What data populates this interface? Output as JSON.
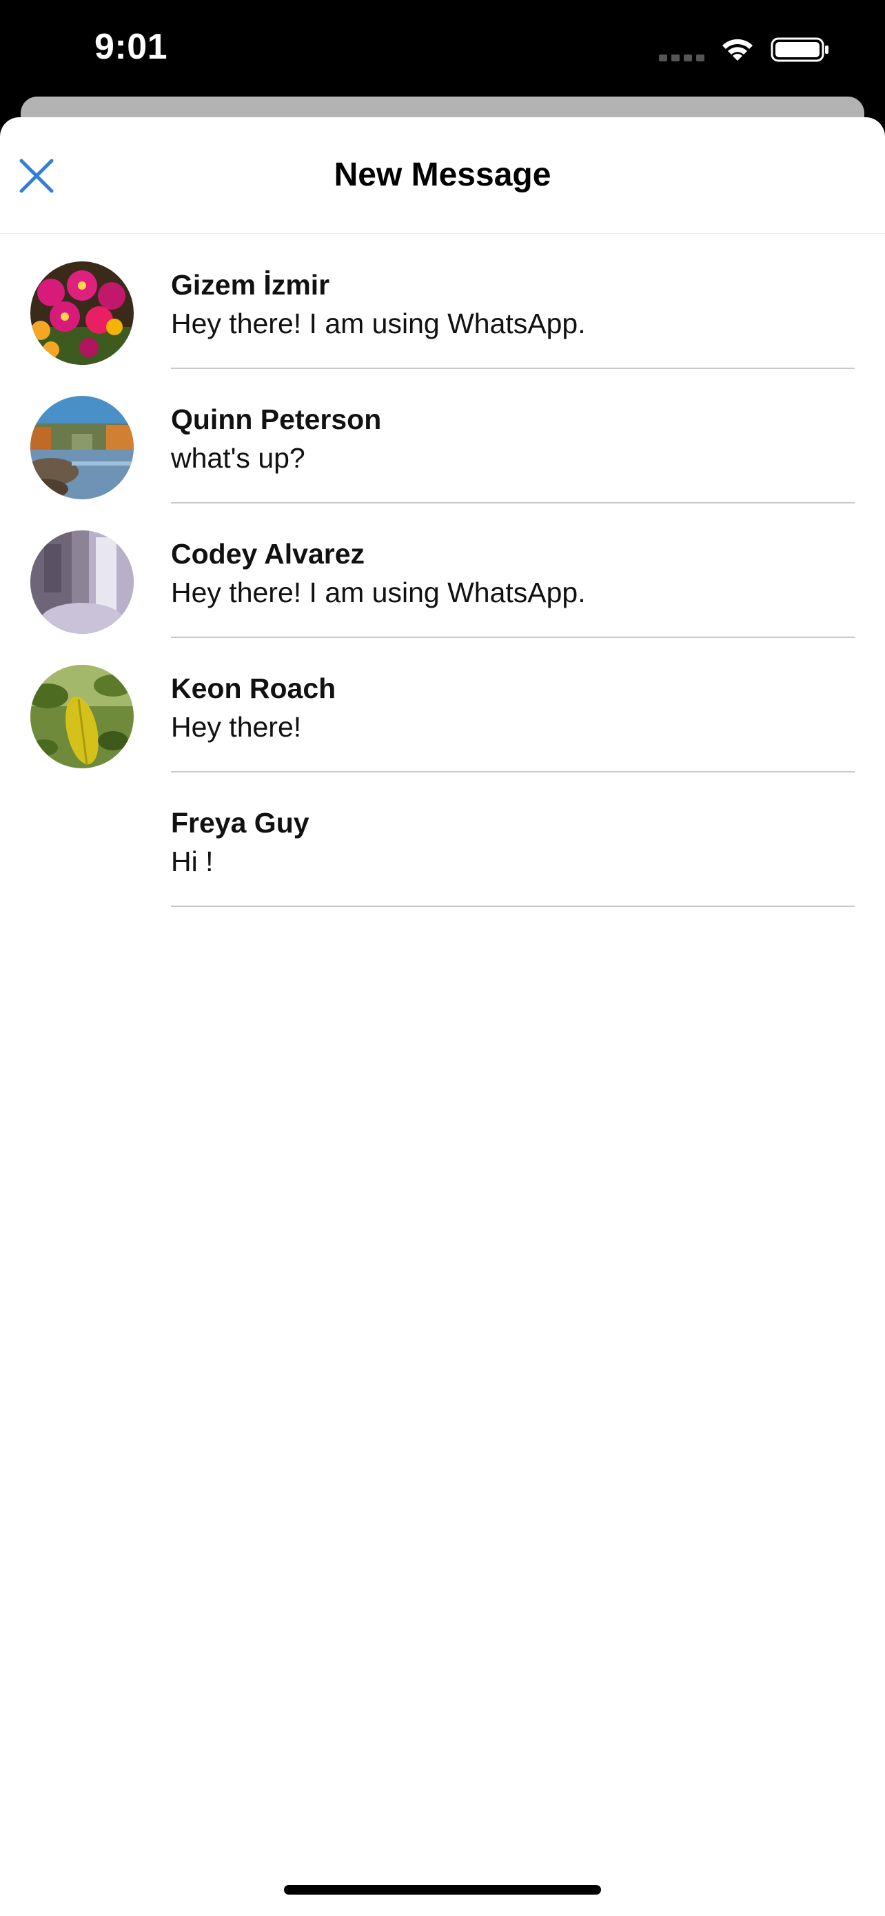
{
  "status_bar": {
    "time": "9:01"
  },
  "nav": {
    "title": "New Message",
    "close_icon": "close-icon"
  },
  "colors": {
    "accent": "#2f7fd6"
  },
  "contacts": [
    {
      "name": "Gizem İzmir",
      "status": "Hey there! I am using WhatsApp.",
      "avatar": "flowers"
    },
    {
      "name": "Quinn Peterson",
      "status": "what's up?",
      "avatar": "lake"
    },
    {
      "name": "Codey Alvarez",
      "status": "Hey there! I am using WhatsApp.",
      "avatar": "waterfall"
    },
    {
      "name": "Keon Roach",
      "status": "Hey there!",
      "avatar": "leaf"
    },
    {
      "name": "Freya Guy",
      "status": "Hi !",
      "avatar": "none"
    }
  ]
}
